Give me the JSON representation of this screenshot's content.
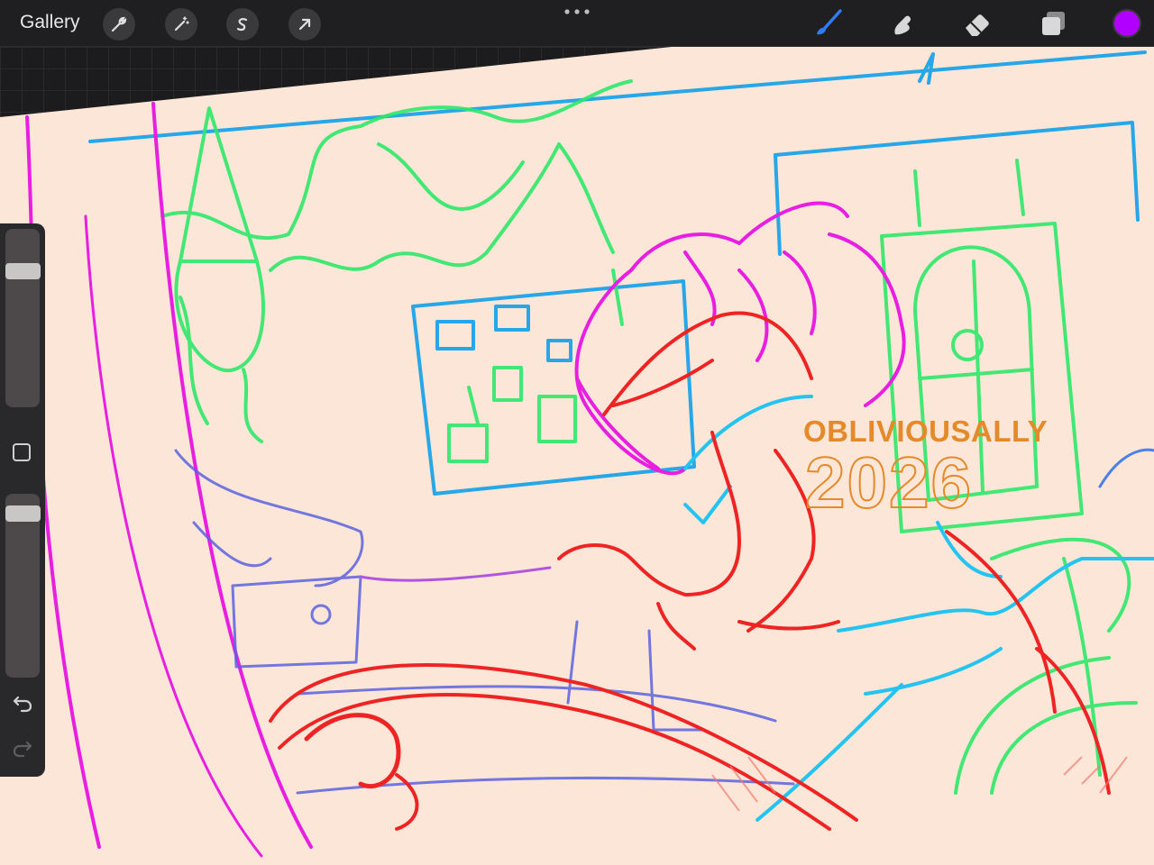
{
  "topbar": {
    "gallery_label": "Gallery",
    "left_tools": [
      "wrench-icon",
      "magic-wand-icon",
      "selection-s-icon",
      "transform-arrow-icon"
    ],
    "right_tools": [
      "brush-icon",
      "smudge-icon",
      "eraser-icon",
      "layers-icon"
    ],
    "active_tool": "brush-icon",
    "active_color": "#b100ff"
  },
  "sidebar": {
    "brush_size_level": 0.2,
    "brush_opacity_level": 0.05,
    "modify_button": "square-icon",
    "undo": "undo-icon",
    "redo": "redo-icon"
  },
  "canvas": {
    "paper_color": "#fbe6d7",
    "watermark": {
      "name": "OBLIVIOUSALLY",
      "year": "2026",
      "color": "#e58a2a"
    },
    "stroke_colors": {
      "blue": "#27a6e8",
      "green": "#2ee86a",
      "magenta": "#e81ee0",
      "red": "#ee2424",
      "indigo": "#5b63e0",
      "cyan": "#25c4f0"
    }
  }
}
